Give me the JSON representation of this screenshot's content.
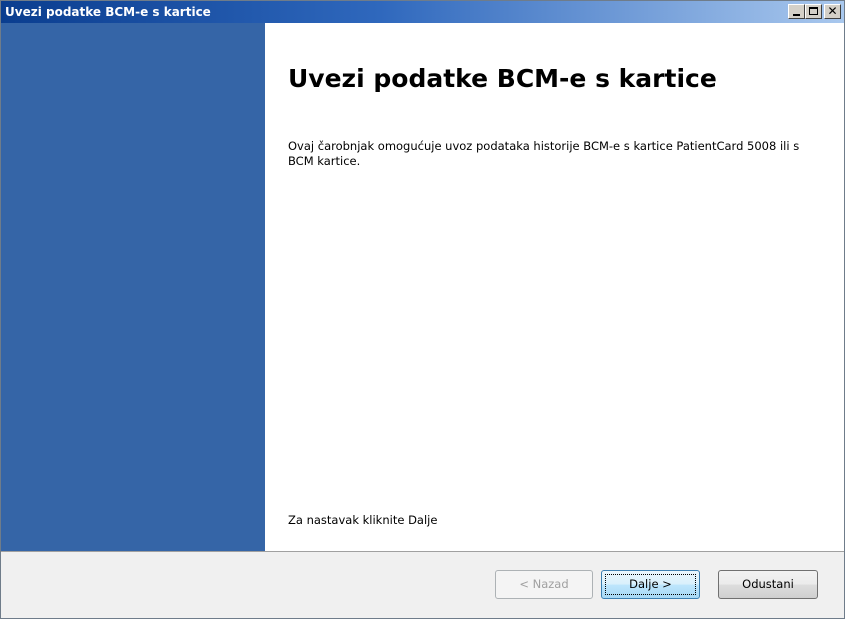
{
  "window": {
    "title": "Uvezi podatke BCM-e s kartice",
    "controls": {
      "minimize_icon": "minimize-icon",
      "maximize_icon": "maximize-icon",
      "close_icon": "close-icon",
      "close_glyph": "✕"
    }
  },
  "wizard": {
    "heading": "Uvezi podatke BCM-e s kartice",
    "description": "Ovaj čarobnjak omogućuje uvoz podataka historije BCM-e s kartice PatientCard 5008 ili s BCM kartice.",
    "continue_hint": "Za nastavak kliknite Dalje"
  },
  "buttons": {
    "back": "< Nazad",
    "next": "Dalje >",
    "cancel": "Odustani"
  },
  "colors": {
    "sidebar": "#3565a7",
    "titlebar_start": "#0a3d8f",
    "titlebar_end": "#a9c8ee"
  }
}
